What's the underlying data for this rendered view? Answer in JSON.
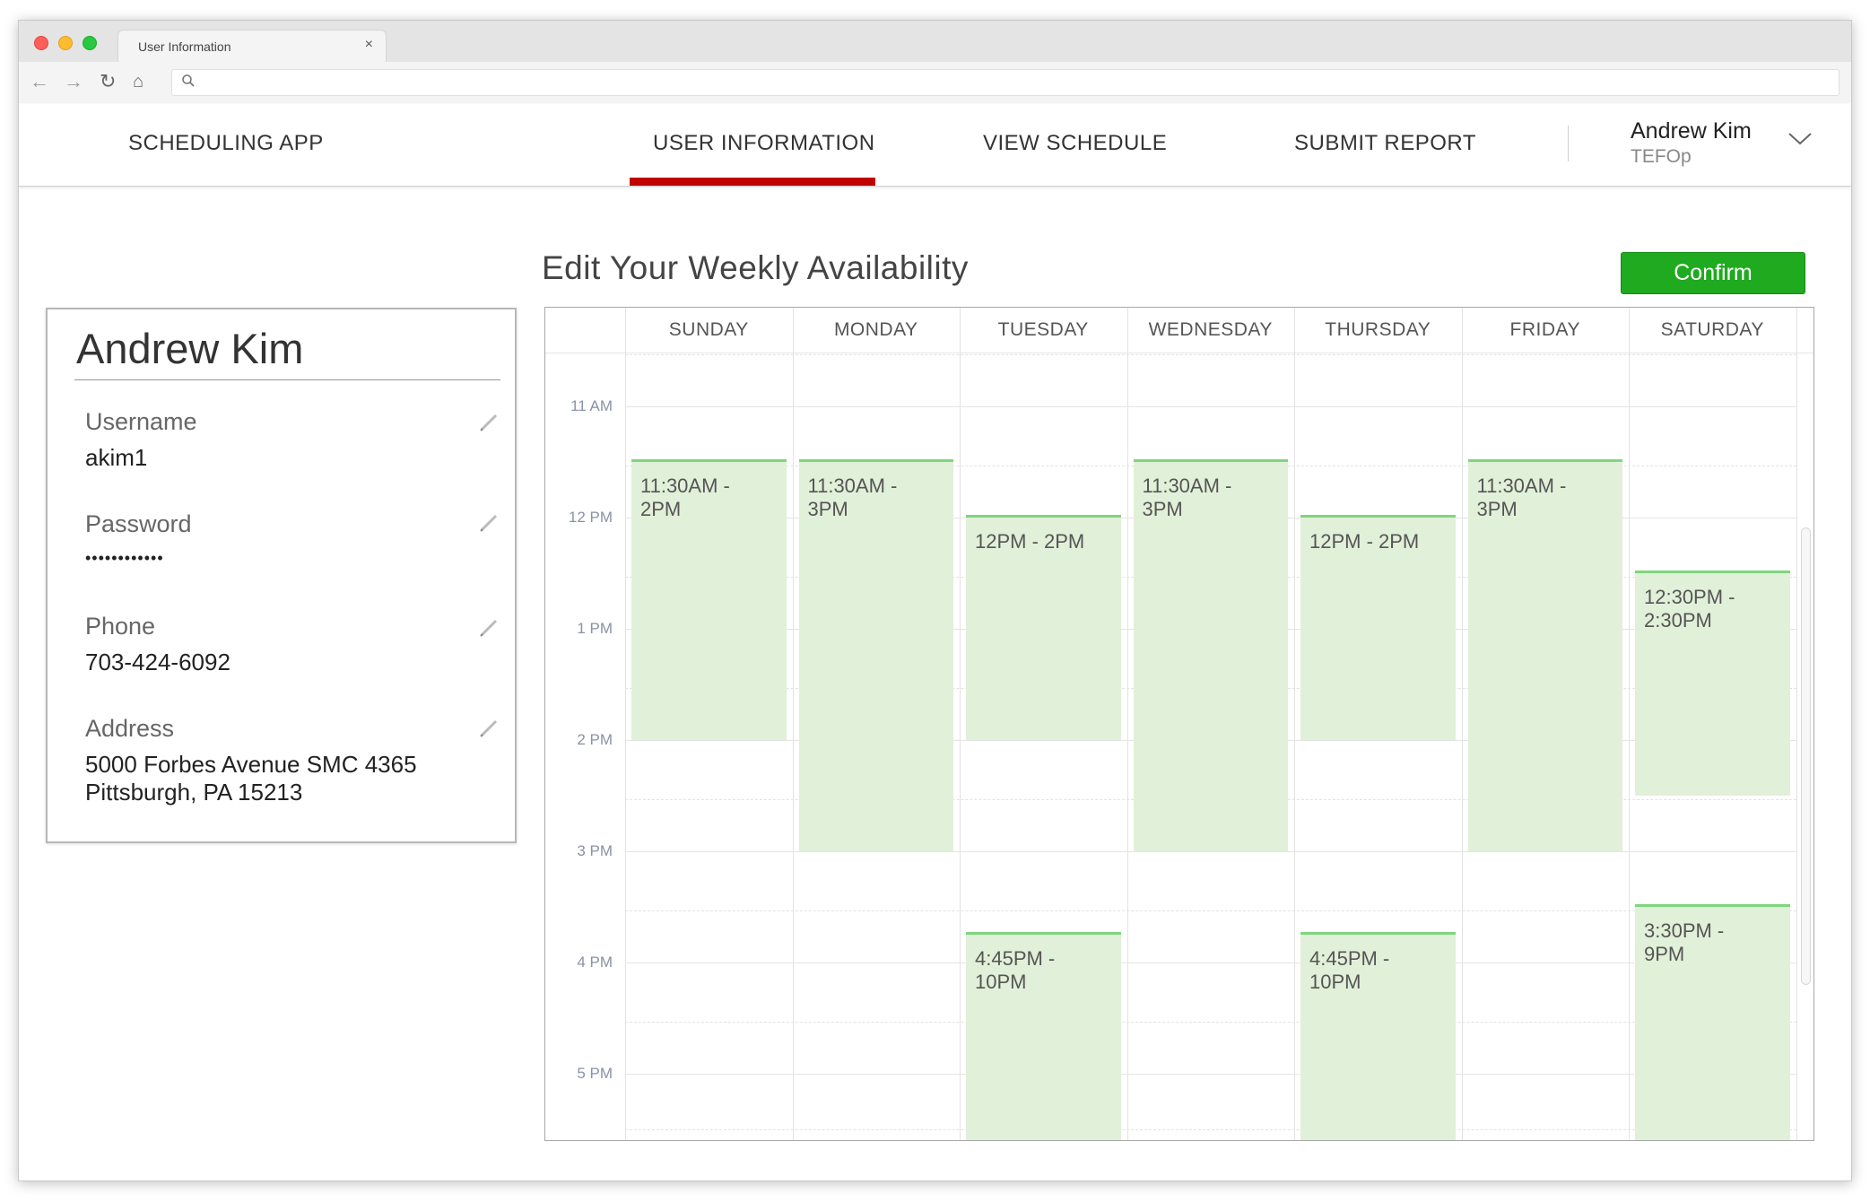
{
  "browser": {
    "tab_title": "User Information",
    "tab_close": "×"
  },
  "header": {
    "brand": "SCHEDULING APP",
    "nav": [
      "USER INFORMATION",
      "VIEW SCHEDULE",
      "SUBMIT REPORT"
    ],
    "active_nav": "USER INFORMATION",
    "user_name": "Andrew Kim",
    "user_org": "TEFOp"
  },
  "profile": {
    "name": "Andrew Kim",
    "fields": [
      {
        "label": "Username",
        "value": "akim1"
      },
      {
        "label": "Password",
        "value": "••••••••••••"
      },
      {
        "label": "Phone",
        "value": "703-424-6092"
      },
      {
        "label": "Address",
        "value": "5000 Forbes Avenue SMC 4365",
        "value2": "Pittsburgh, PA 15213"
      }
    ]
  },
  "schedule": {
    "title": "Edit Your Weekly Availability",
    "confirm_label": "Confirm",
    "days": [
      "SUNDAY",
      "MONDAY",
      "TUESDAY",
      "WEDNESDAY",
      "THURSDAY",
      "FRIDAY",
      "SATURDAY"
    ],
    "times": [
      "11 AM",
      "12 PM",
      "1 PM",
      "2 PM",
      "3 PM",
      "4 PM",
      "5 PM"
    ],
    "blocks": [
      {
        "day": "SUNDAY",
        "line1": "11:30AM -",
        "line2": "2PM"
      },
      {
        "day": "MONDAY",
        "line1": "11:30AM -",
        "line2": "3PM"
      },
      {
        "day": "TUESDAY",
        "line1": "12PM - 2PM",
        "line2": ""
      },
      {
        "day": "TUESDAY",
        "line1": "4:45PM -",
        "line2": "10PM"
      },
      {
        "day": "WEDNESDAY",
        "line1": "11:30AM -",
        "line2": "3PM"
      },
      {
        "day": "THURSDAY",
        "line1": "12PM - 2PM",
        "line2": ""
      },
      {
        "day": "THURSDAY",
        "line1": "4:45PM -",
        "line2": "10PM"
      },
      {
        "day": "FRIDAY",
        "line1": "11:30AM -",
        "line2": "3PM"
      },
      {
        "day": "SATURDAY",
        "line1": "12:30PM -",
        "line2": "2:30PM"
      },
      {
        "day": "SATURDAY",
        "line1": "3:30PM -",
        "line2": "9PM"
      }
    ]
  },
  "colors": {
    "accent_red": "#c00000",
    "confirm_green": "#1faa1f",
    "block_fill": "#e1f0d9",
    "block_border": "#7ed67e"
  },
  "icons": {
    "back": "arrow-left-icon",
    "forward": "arrow-right-icon",
    "reload": "reload-icon",
    "home": "home-icon",
    "search": "search-icon",
    "edit": "pencil-icon",
    "dropdown": "chevron-down-icon"
  }
}
